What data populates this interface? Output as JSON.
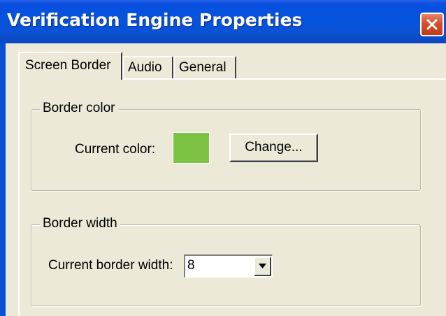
{
  "window": {
    "title": "Verification Engine Properties"
  },
  "tabs": [
    {
      "label": "Screen Border",
      "active": true
    },
    {
      "label": "Audio",
      "active": false
    },
    {
      "label": "General",
      "active": false
    }
  ],
  "border_color_group": {
    "legend": "Border color",
    "current_color_label": "Current color:",
    "current_color_value": "#7cc243",
    "change_button_label": "Change..."
  },
  "border_width_group": {
    "legend": "Border width",
    "current_width_label": "Current border width:",
    "current_width_value": "8"
  },
  "icons": {
    "close": "close-icon",
    "dropdown": "chevron-down-icon"
  },
  "colors": {
    "titlebar": "#0453dd",
    "close_button": "#d4502c",
    "dialog_background": "#ece9d8"
  }
}
